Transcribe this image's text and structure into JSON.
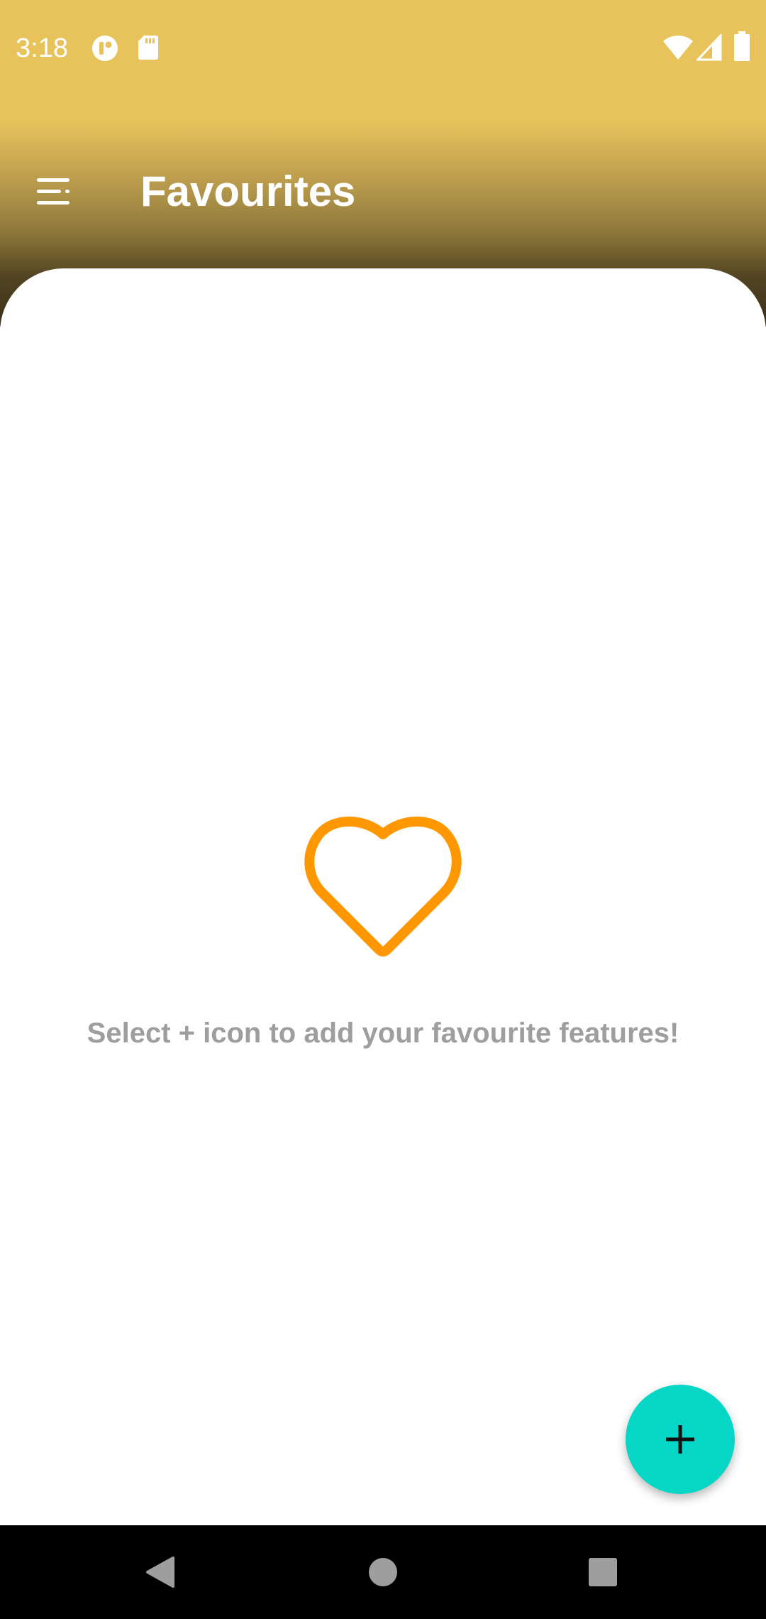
{
  "status_bar": {
    "time": "3:18",
    "icons": [
      "app-notification-icon",
      "sd-card-icon",
      "wifi-icon",
      "signal-icon",
      "battery-icon"
    ]
  },
  "app_bar": {
    "title": "Favourites",
    "menu_icon": "menu-icon"
  },
  "empty_state": {
    "icon": "heart-outline-icon",
    "message": "Select + icon to add your favourite features!"
  },
  "fab": {
    "icon": "plus-icon"
  },
  "nav_bar": {
    "buttons": [
      "back-icon",
      "home-icon",
      "recents-icon"
    ]
  },
  "colors": {
    "header": "#e8c35c",
    "heart": "#ff9800",
    "fab": "#06d6c6",
    "message_text": "#9e9e9e"
  }
}
